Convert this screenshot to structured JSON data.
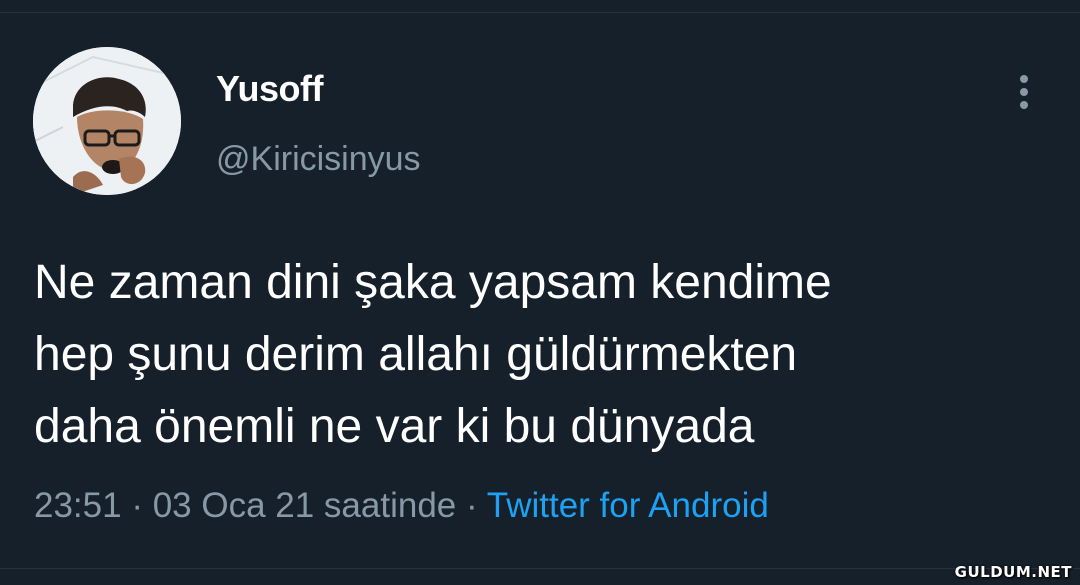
{
  "tweet": {
    "author": {
      "display_name": "Yusoff",
      "handle": "@Kiricisinyus"
    },
    "more_icon": "vertical-ellipsis-icon",
    "text_lines": [
      "Ne zaman dini şaka yapsam kendime",
      "hep şunu derim allahı güldürmekten",
      "daha önemli ne var ki bu dünyada"
    ],
    "meta": {
      "time": "23:51",
      "separator": " · ",
      "date": "03 Oca 21 saatinde",
      "source": "Twitter for Android"
    }
  },
  "watermark": "GULDUM.NET",
  "colors": {
    "background": "#15202b",
    "text_primary": "#ffffff",
    "text_secondary": "#8899a6",
    "link": "#1da1f2"
  }
}
